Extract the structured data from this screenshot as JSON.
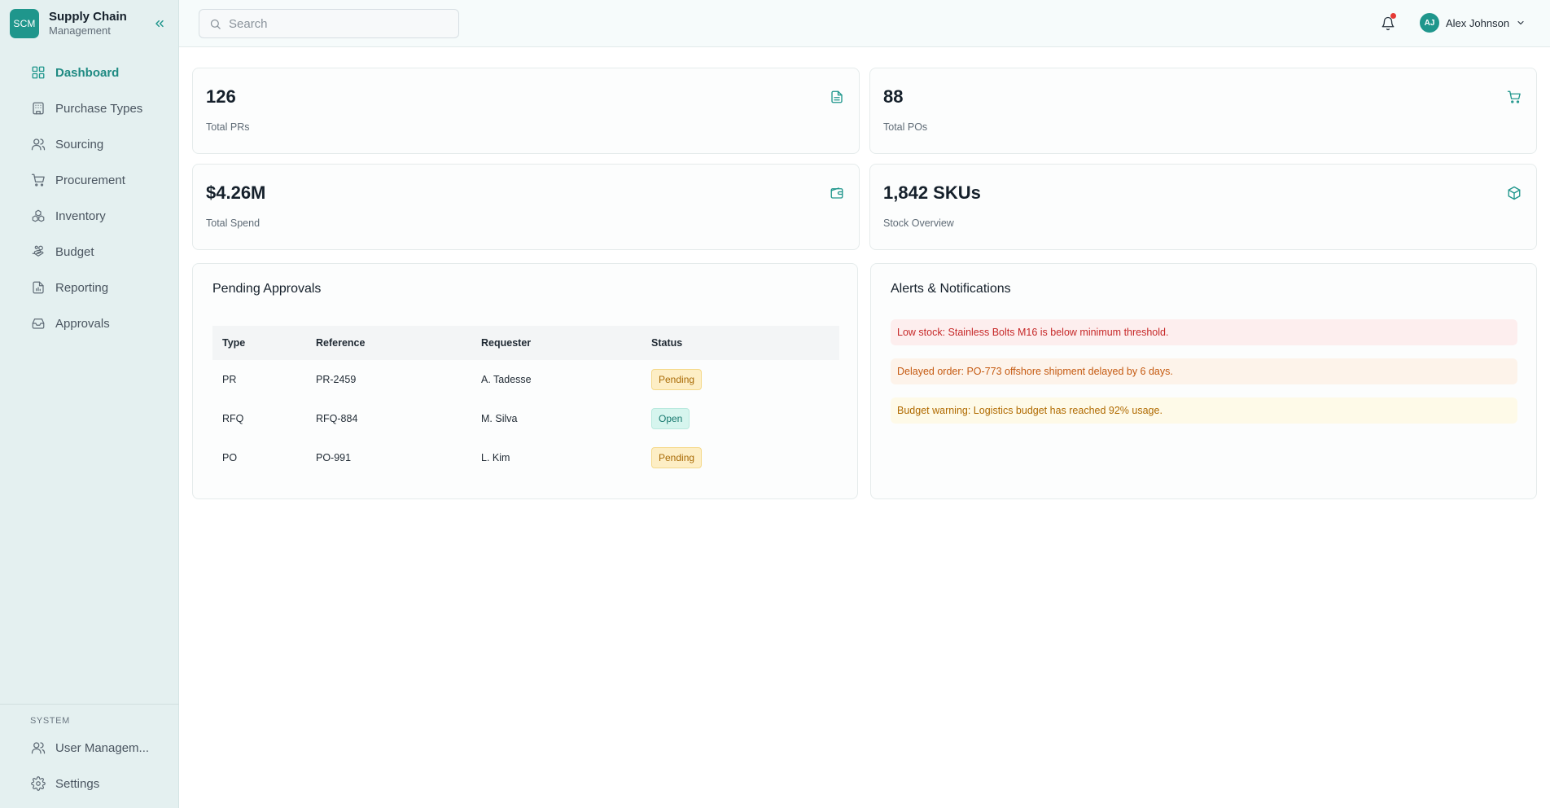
{
  "brand": {
    "logo": "SCM",
    "title": "Supply Chain",
    "subtitle": "Management"
  },
  "nav": [
    {
      "label": "Dashboard",
      "icon": "dashboard-icon",
      "active": true
    },
    {
      "label": "Purchase Types",
      "icon": "building-icon"
    },
    {
      "label": "Sourcing",
      "icon": "users-icon"
    },
    {
      "label": "Procurement",
      "icon": "cart-icon"
    },
    {
      "label": "Inventory",
      "icon": "boxes-icon"
    },
    {
      "label": "Budget",
      "icon": "hand-coins-icon"
    },
    {
      "label": "Reporting",
      "icon": "report-icon"
    },
    {
      "label": "Approvals",
      "icon": "inbox-icon"
    }
  ],
  "system": {
    "label": "SYSTEM",
    "items": [
      {
        "label": "User Managem...",
        "icon": "users-icon"
      },
      {
        "label": "Settings",
        "icon": "gear-icon"
      }
    ]
  },
  "topbar": {
    "search_placeholder": "Search",
    "user": {
      "initials": "AJ",
      "name": "Alex Johnson"
    }
  },
  "stats": [
    {
      "value": "126",
      "label": "Total PRs",
      "icon": "document-icon"
    },
    {
      "value": "88",
      "label": "Total POs",
      "icon": "cart-icon"
    },
    {
      "value": "$4.26M",
      "label": "Total Spend",
      "icon": "wallet-icon"
    },
    {
      "value": "1,842 SKUs",
      "label": "Stock Overview",
      "icon": "package-icon"
    }
  ],
  "approvals": {
    "title": "Pending Approvals",
    "columns": [
      "Type",
      "Reference",
      "Requester",
      "Status"
    ],
    "rows": [
      {
        "type": "PR",
        "reference": "PR-2459",
        "requester": "A. Tadesse",
        "status": "Pending"
      },
      {
        "type": "RFQ",
        "reference": "RFQ-884",
        "requester": "M. Silva",
        "status": "Open"
      },
      {
        "type": "PO",
        "reference": "PO-991",
        "requester": "L. Kim",
        "status": "Pending"
      }
    ]
  },
  "alerts": {
    "title": "Alerts & Notifications",
    "items": [
      {
        "text": "Low stock: Stainless Bolts M16 is below minimum threshold.",
        "level": "red"
      },
      {
        "text": "Delayed order: PO-773 offshore shipment delayed by 6 days.",
        "level": "orange"
      },
      {
        "text": "Budget warning: Logistics budget has reached 92% usage.",
        "level": "yellow"
      }
    ]
  },
  "colors": {
    "accent": "#1f968c",
    "sidebar_bg": "#e4f0f0",
    "notification_dot": "#e53935"
  }
}
